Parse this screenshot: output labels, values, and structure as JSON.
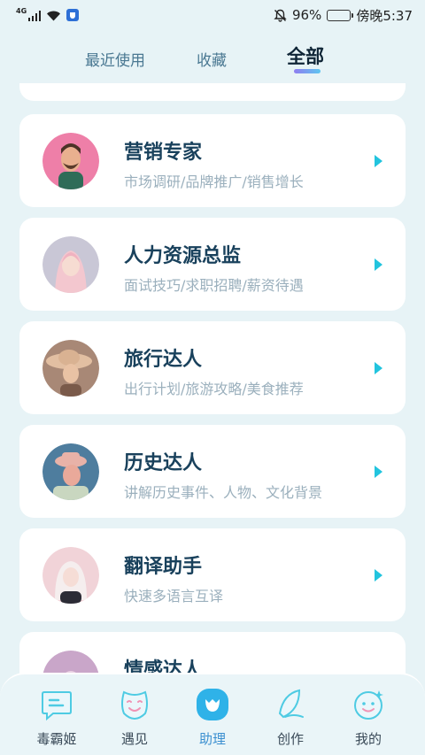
{
  "status_bar": {
    "network": "4G",
    "battery_percent": "96%",
    "time": "傍晚5:37"
  },
  "tabs": [
    {
      "label": "最近使用",
      "active": false
    },
    {
      "label": "收藏",
      "active": false
    },
    {
      "label": "全部",
      "active": true
    }
  ],
  "assistants": [
    {
      "title": "营销专家",
      "subtitle": "市场调研/品牌推广/销售增长",
      "avatar_colors": [
        "#ee7fa8",
        "#f6b6c9"
      ]
    },
    {
      "title": "人力资源总监",
      "subtitle": "面试技巧/求职招聘/薪资待遇",
      "avatar_colors": [
        "#c9c7d6",
        "#f0dde0"
      ]
    },
    {
      "title": "旅行达人",
      "subtitle": "出行计划/旅游攻略/美食推荐",
      "avatar_colors": [
        "#b48c78",
        "#e8c4a6"
      ]
    },
    {
      "title": "历史达人",
      "subtitle": "讲解历史事件、人物、文化背景",
      "avatar_colors": [
        "#5a86a8",
        "#e7b6a6"
      ]
    },
    {
      "title": "翻译助手",
      "subtitle": "快速多语言互译",
      "avatar_colors": [
        "#f0d2d6",
        "#e8e0e4"
      ]
    },
    {
      "title": "情感达人",
      "subtitle": "",
      "avatar_colors": [
        "#c9a6c9",
        "#ead2e4"
      ]
    }
  ],
  "bottom_nav": [
    {
      "label": "毒霸姬",
      "icon": "chat-bubble-icon",
      "active": false
    },
    {
      "label": "遇见",
      "icon": "mask-icon",
      "active": false
    },
    {
      "label": "助理",
      "icon": "assistant-icon",
      "active": true
    },
    {
      "label": "创作",
      "icon": "feather-icon",
      "active": false
    },
    {
      "label": "我的",
      "icon": "smiley-icon",
      "active": false
    }
  ],
  "colors": {
    "accent": "#22c4de",
    "background": "#e7f3f6",
    "title": "#19415c",
    "subtitle": "#9bb0bd"
  }
}
